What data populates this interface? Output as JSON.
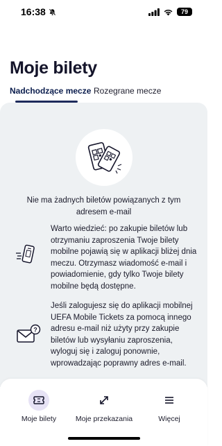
{
  "status_bar": {
    "time": "16:38",
    "battery": "79"
  },
  "header": {
    "title": "Moje bilety"
  },
  "tabs": [
    {
      "label": "Nadchodzące mecze",
      "active": true
    },
    {
      "label": "Rozegrane mecze",
      "active": false
    }
  ],
  "empty_state": {
    "message": "Nie ma żadnych biletów powiązanych z tym adresem e-mail"
  },
  "info_blocks": [
    {
      "icon": "mobile-ticket-icon",
      "text": "Warto wiedzieć: po zakupie biletów lub otrzymaniu zaproszenia Twoje bilety mobilne pojawią się w aplikacji bliżej dnia meczu. Otrzymasz wiadomość e-mail i powiadomienie, gdy tylko Twoje bilety mobilne będą dostępne."
    },
    {
      "icon": "email-question-icon",
      "text": "Jeśli zalogujesz się do aplikacji mobilnej UEFA Mobile Tickets za pomocą innego adresu e-mail niż użyty przy zakupie biletów lub wysyłaniu zaproszenia, wyloguj się i zaloguj ponownie, wprowadzając poprawny adres e-mail."
    }
  ],
  "bottom_nav": [
    {
      "label": "Moje bilety",
      "icon": "ticket-icon",
      "active": true
    },
    {
      "label": "Moje przekazania",
      "icon": "transfer-arrows-icon",
      "active": false
    },
    {
      "label": "Więcej",
      "icon": "menu-icon",
      "active": false
    }
  ],
  "colors": {
    "accent": "#1d2a5b",
    "panel_bg": "#eef1f3",
    "active_nav_bg": "#e6e2f5"
  }
}
